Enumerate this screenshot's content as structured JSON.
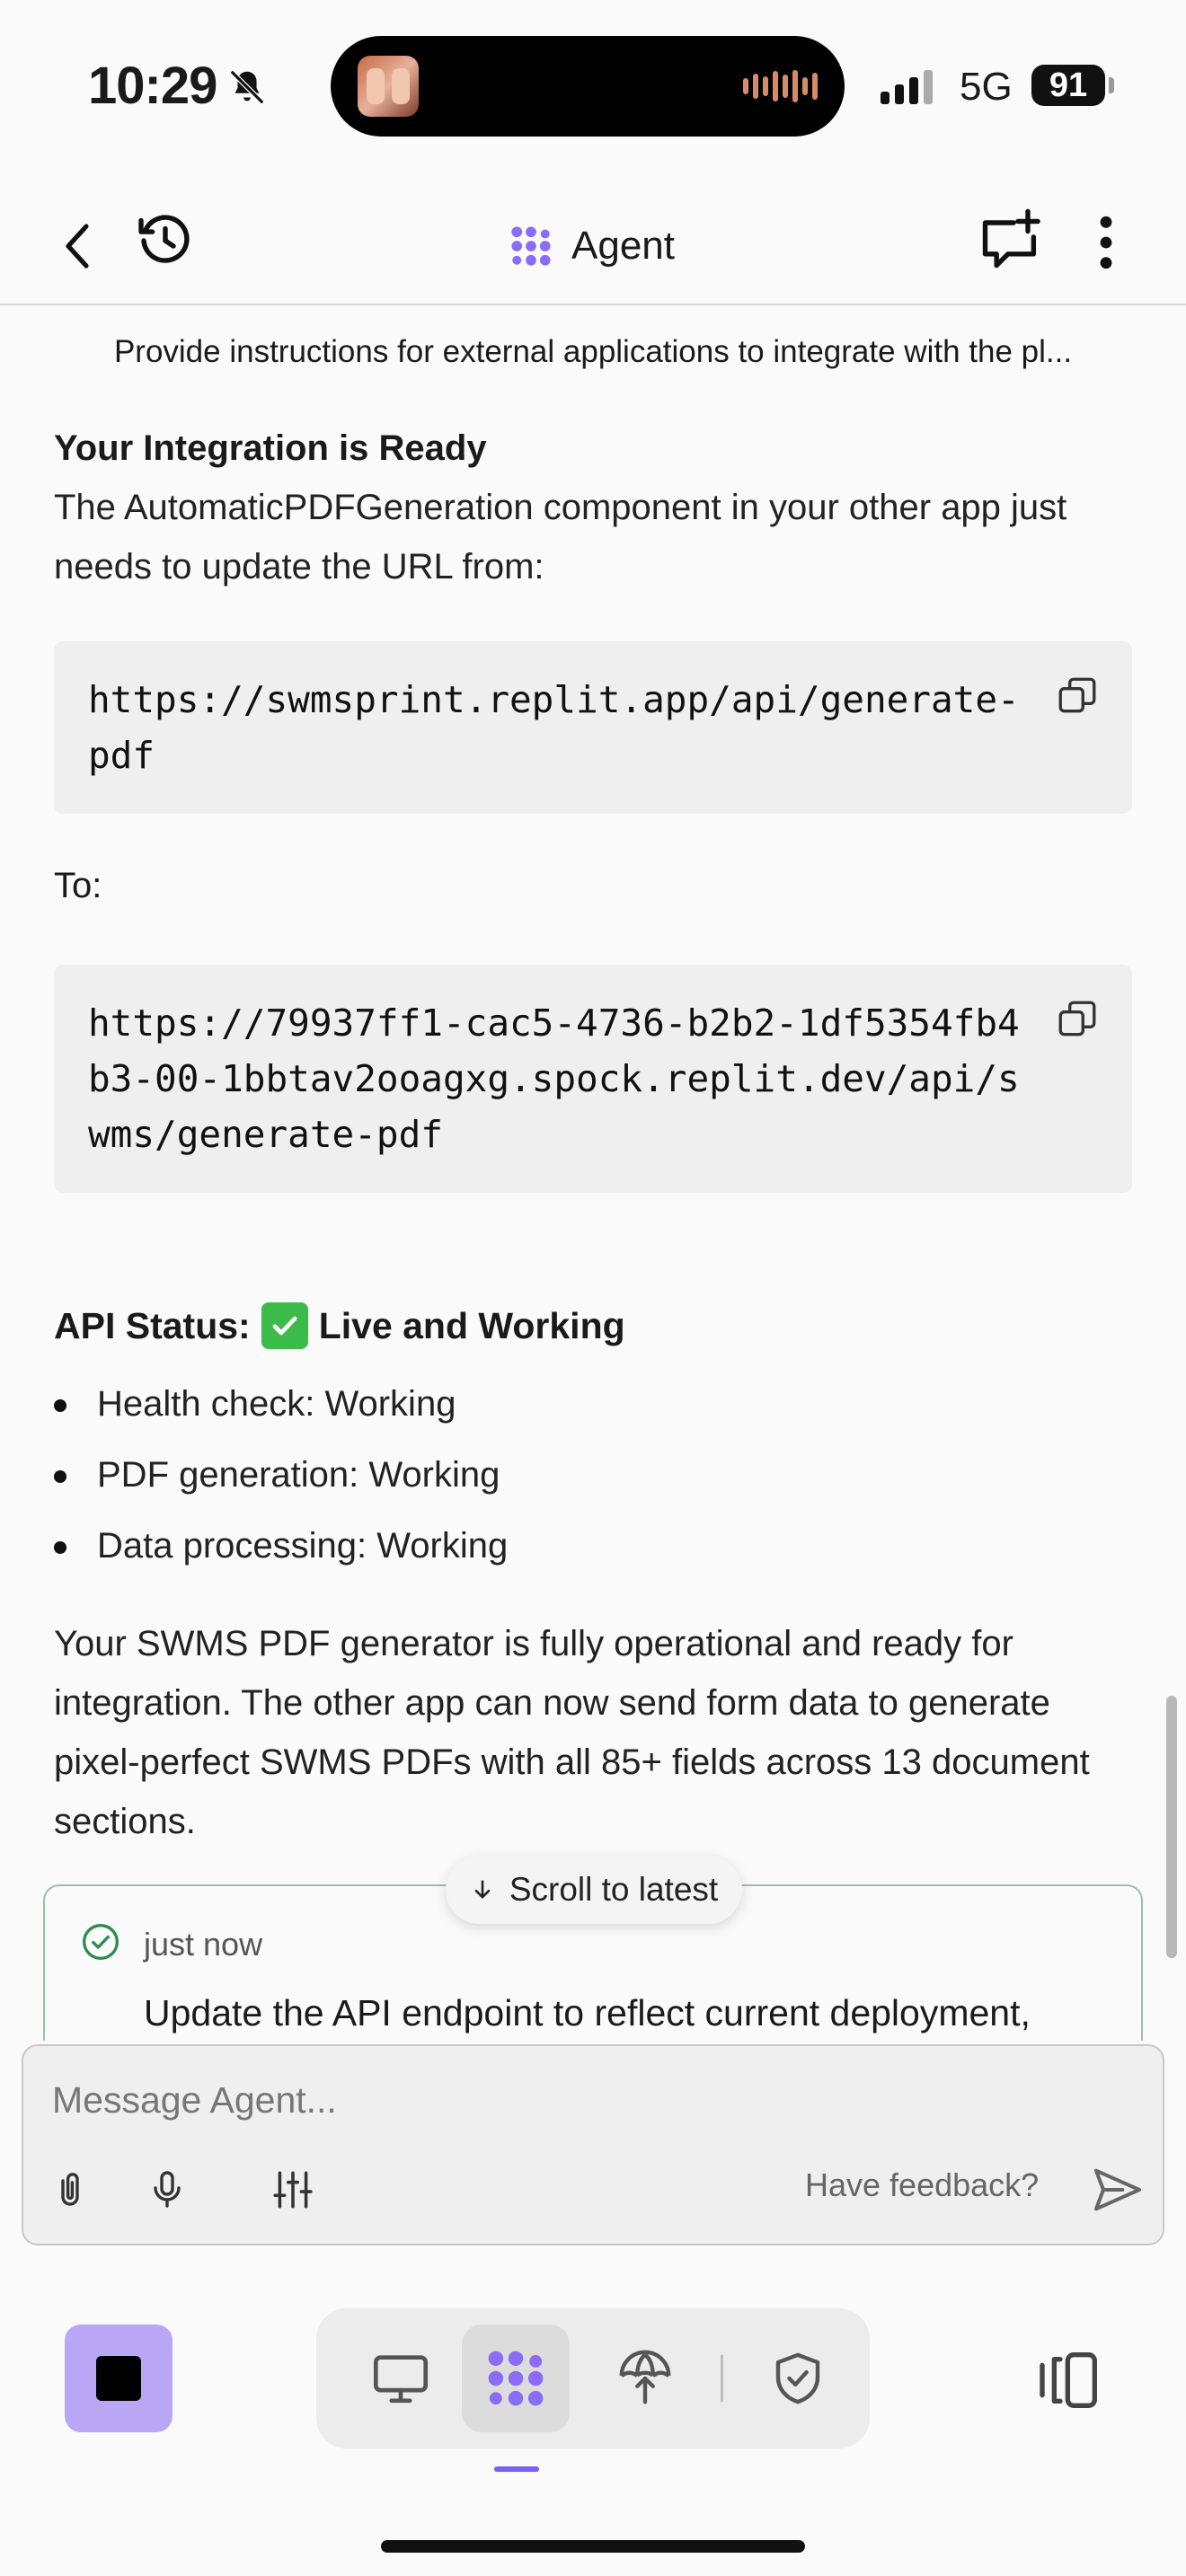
{
  "status_bar": {
    "time": "10:29",
    "network": "5G",
    "battery": "91"
  },
  "nav": {
    "title": "Agent"
  },
  "chat": {
    "task_title": "Provide instructions for external applications to integrate with the pl...",
    "heading": "Your Integration is Ready",
    "intro": "The AutomaticPDFGeneration component in your other app just needs to update the URL from:",
    "old_url": "https://swmsprint.replit.app/api/generate-pdf",
    "to_label": "To:",
    "new_url": "https://79937ff1-cac5-4736-b2b2-1df5354fb4b3-00-1bbtav2ooagxg.spock.replit.dev/api/swms/generate-pdf",
    "api_status_label": "API Status:",
    "api_status_value": "Live and Working",
    "status_items": [
      "Health check: Working",
      "PDF generation: Working",
      "Data processing: Working"
    ],
    "summary": "Your SWMS PDF generator is fully operational and ready for integration. The other app can now send form data to generate pixel-perfect SWMS PDFs with all 85+ fields across 13 document sections."
  },
  "checkpoint": {
    "time": "just now",
    "text": "Update the API endpoint to reflect current deployment,"
  },
  "scroll_latest": "Scroll to latest",
  "composer": {
    "placeholder": "Message Agent...",
    "feedback": "Have feedback?"
  },
  "icons": {
    "back": "chevron-left-icon",
    "history": "history-icon",
    "agent": "agent-logo-icon",
    "new_chat": "new-chat-icon",
    "more": "more-vertical-icon",
    "copy": "copy-icon",
    "attach": "paperclip-icon",
    "mic": "microphone-icon",
    "settings": "sliders-icon",
    "send": "send-icon"
  },
  "colors": {
    "accent": "#7c5cf6",
    "stop_button": "#b9a7f5",
    "status_check": "#3dbb4a",
    "checkpoint_border": "#9bbfae"
  }
}
